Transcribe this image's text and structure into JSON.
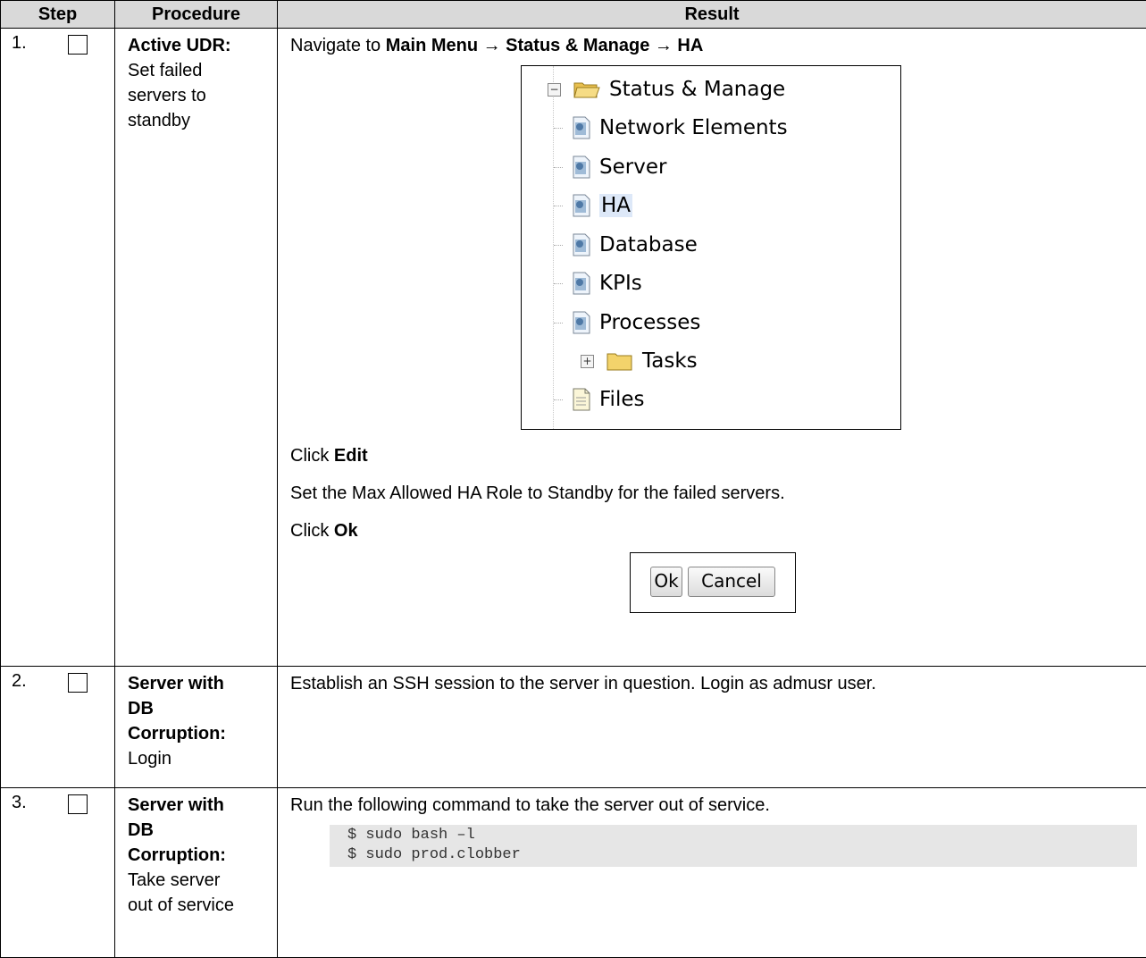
{
  "headers": {
    "step": "Step",
    "procedure": "Procedure",
    "result": "Result"
  },
  "steps": [
    {
      "number": "1.",
      "proc_bold": "Active UDR:",
      "proc_text": [
        "Set failed",
        "servers to",
        "standby"
      ],
      "navigate_prefix": "Navigate to ",
      "navigate_path": "Main Menu → Status & Manage → HA",
      "tree": {
        "root": "Status & Manage",
        "items": [
          "Network Elements",
          "Server",
          "HA",
          "Database",
          "KPIs",
          "Processes"
        ],
        "tasks": "Tasks",
        "files": "Files",
        "selected": "HA",
        "collapse_glyph": "−",
        "expand_glyph": "+"
      },
      "click_edit_prefix": "Click ",
      "click_edit_bold": "Edit",
      "set_text": "Set the Max Allowed HA Role to Standby for the failed servers.",
      "click_ok_prefix": "Click ",
      "click_ok_bold": "Ok",
      "buttons": {
        "ok": "Ok",
        "cancel": "Cancel"
      }
    },
    {
      "number": "2.",
      "proc_bold": [
        "Server with",
        "DB",
        "Corruption:"
      ],
      "proc_text": [
        "Login"
      ],
      "result": "Establish an SSH session to the server in question. Login as admusr user."
    },
    {
      "number": "3.",
      "proc_bold": [
        "Server with",
        "DB",
        "Corruption:"
      ],
      "proc_text": [
        "Take server",
        "out of service"
      ],
      "result": "Run the following command to take the server out of service.",
      "code": [
        "$ sudo bash –l",
        "$ sudo prod.clobber"
      ]
    }
  ],
  "colors": {
    "header_bg": "#d9d9d9",
    "code_bg": "#e6e6e6",
    "folder": "#f3d36b",
    "selection": "#dde8f8"
  }
}
